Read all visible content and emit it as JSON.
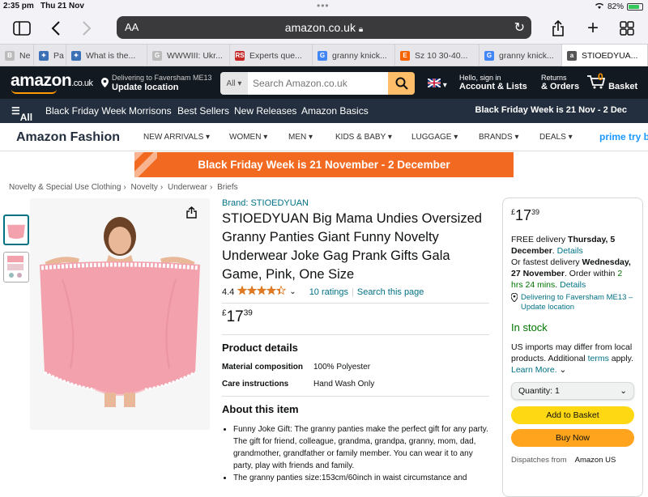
{
  "status": {
    "time": "2:35 pm",
    "date": "Thu 21 Nov",
    "battery": "82%",
    "battery_level": 0.82
  },
  "browser": {
    "reader_label": "AA",
    "url": "amazon.co.uk",
    "tabs": [
      {
        "label": "Ne",
        "fav": "B",
        "fav_color": "#bbbbbb"
      },
      {
        "label": "Pa",
        "fav": "✦",
        "fav_color": "#3b6fb6"
      },
      {
        "label": "What is the...",
        "fav": "✦",
        "fav_color": "#3b6fb6"
      },
      {
        "label": "WWWIII: Ukr...",
        "fav": "G",
        "fav_color": "#bbbbbb"
      },
      {
        "label": "Experts que...",
        "fav": "RS",
        "fav_color": "#c62828"
      },
      {
        "label": "granny knick...",
        "fav": "G",
        "fav_color": "#4285f4"
      },
      {
        "label": "Sz 10 30-40...",
        "fav": "E",
        "fav_color": "#f56400"
      },
      {
        "label": "granny knick...",
        "fav": "G",
        "fav_color": "#4285f4"
      },
      {
        "label": "STIOEDYUA...",
        "fav": "a",
        "fav_color": "#555555"
      }
    ]
  },
  "nav": {
    "logo": "amazon",
    "logo_suffix": ".co.uk",
    "deliver_line1": "Delivering to Faversham ME13",
    "deliver_line2": "Update location",
    "search_category": "All",
    "search_placeholder": "Search Amazon.co.uk",
    "account_line1": "Hello, sign in",
    "account_line2": "Account & Lists",
    "returns_line1": "Returns",
    "returns_line2": "& Orders",
    "basket_count": "0",
    "basket_label": "Basket"
  },
  "subnav": {
    "all": "All",
    "items": [
      "Black Friday Week",
      "Morrisons",
      "Best Sellers",
      "New Releases",
      "Amazon Basics"
    ],
    "promo": "Black Friday Week is 21 Nov - 2 Dec"
  },
  "fashion": {
    "brand": "Amazon Fashion",
    "items": [
      "NEW ARRIVALS",
      "WOMEN",
      "MEN",
      "KIDS & BABY",
      "LUGGAGE",
      "BRANDS",
      "DEALS"
    ],
    "prime": "prime try be"
  },
  "banner": "Black Friday Week is 21 November - 2 December",
  "breadcrumbs": [
    "Novelty & Special Use Clothing",
    "Novelty",
    "Underwear",
    "Briefs"
  ],
  "product": {
    "brand_link": "Brand: STIOEDYUAN",
    "title": "STIOEDYUAN Big Mama Undies Oversized Granny Panties Giant Funny Novelty Underwear Joke Gag Prank Gifts Gala Game, Pink, One Size",
    "rating_value": "4.4",
    "rating_stars": 4.4,
    "ratings_count": "10 ratings",
    "search_page": "Search this page",
    "price_symbol": "£",
    "price_whole": "17",
    "price_fraction": "39",
    "details_heading": "Product details",
    "details": [
      {
        "key": "Material composition",
        "value": "100% Polyester"
      },
      {
        "key": "Care instructions",
        "value": "Hand Wash Only"
      }
    ],
    "about_heading": "About this item",
    "about": [
      "Funny Joke Gift: The granny panties make the perfect gift for any party. The gift for friend, colleague, grandma, grandpa, granny, mom, dad, grandmother, grandfather or family member. You can wear it to any party, play with friends and family.",
      "The granny panties size:153cm/60inch in waist circumstance and"
    ],
    "colors": {
      "panty": "#f2a1ad",
      "lace": "#ffffff"
    }
  },
  "buybox": {
    "price_symbol": "£",
    "price_whole": "17",
    "price_fraction": "39",
    "free_delivery_pre": "FREE delivery ",
    "free_delivery_date": "Thursday, 5 December",
    "details": "Details",
    "fastest_pre": "Or fastest delivery ",
    "fastest_date": "Wednesday, 27 November",
    "order_within_pre": ". Order within ",
    "order_within": "2 hrs 24 mins",
    "order_within_post": ". ",
    "location": "Delivering to Faversham ME13 – Update location",
    "stock": "In stock",
    "imports_pre": "US imports may differ from local products. Additional ",
    "terms": "terms",
    "apply": " apply. ",
    "learn_more": "Learn More.",
    "quantity_label": "Quantity:",
    "quantity_value": "1",
    "add_to_basket": "Add to Basket",
    "buy_now": "Buy Now",
    "dispatches_label": "Dispatches from",
    "dispatches_value": "Amazon US"
  }
}
